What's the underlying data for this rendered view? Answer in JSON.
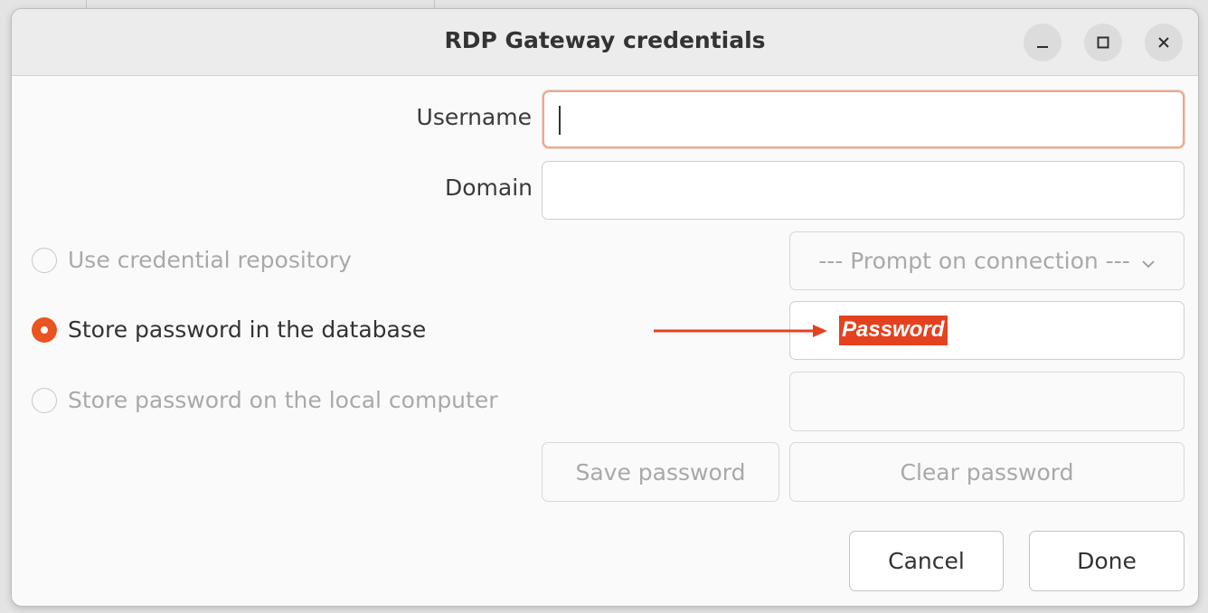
{
  "dialog": {
    "title": "RDP Gateway credentials",
    "window_controls": {
      "minimize_icon": "minimize-icon",
      "maximize_icon": "maximize-icon",
      "close_icon": "close-icon"
    }
  },
  "form": {
    "username_label": "Username",
    "username_value": "",
    "domain_label": "Domain",
    "domain_value": "",
    "radio_options": [
      {
        "label": "Use credential repository",
        "checked": false,
        "enabled": false
      },
      {
        "label": "Store password in the database",
        "checked": true,
        "enabled": true
      },
      {
        "label": "Store password on the local computer",
        "checked": false,
        "enabled": false
      }
    ],
    "repository_select": {
      "selected": "--- Prompt on connection ---"
    },
    "password_annotation": "Password",
    "local_password_value": "",
    "save_password_label": "Save password",
    "clear_password_label": "Clear password"
  },
  "footer": {
    "cancel_label": "Cancel",
    "done_label": "Done"
  },
  "colors": {
    "accent": "#e95420",
    "annotation": "#e4421f"
  }
}
